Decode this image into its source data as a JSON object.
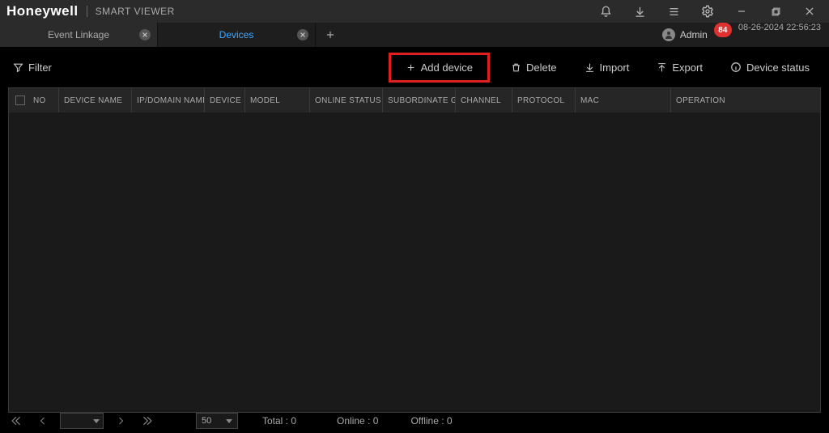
{
  "header": {
    "brand": "Honeywell",
    "app_title": "SMART VIEWER"
  },
  "tabs": [
    {
      "label": "Event Linkage",
      "active": false
    },
    {
      "label": "Devices",
      "active": true
    }
  ],
  "user": {
    "name": "Admin"
  },
  "badge_count": "84",
  "datetime": "08-26-2024 22:56:23",
  "toolbar": {
    "filter": "Filter",
    "add_device": "Add device",
    "delete": "Delete",
    "import": "Import",
    "export": "Export",
    "device_status": "Device status"
  },
  "columns": {
    "no": "NO",
    "device_name": "DEVICE NAME",
    "ip": "IP/DOMAIN NAME",
    "device": "DEVICE",
    "model": "MODEL",
    "online": "ONLINE STATUS",
    "sub": "SUBORDINATE G",
    "channel": "CHANNEL",
    "protocol": "PROTOCOL",
    "mac": "MAC",
    "operation": "OPERATION"
  },
  "footer": {
    "page_size": "50",
    "total_label": "Total :",
    "total_value": "0",
    "online_label": "Online :",
    "online_value": "0",
    "offline_label": "Offline :",
    "offline_value": "0"
  }
}
